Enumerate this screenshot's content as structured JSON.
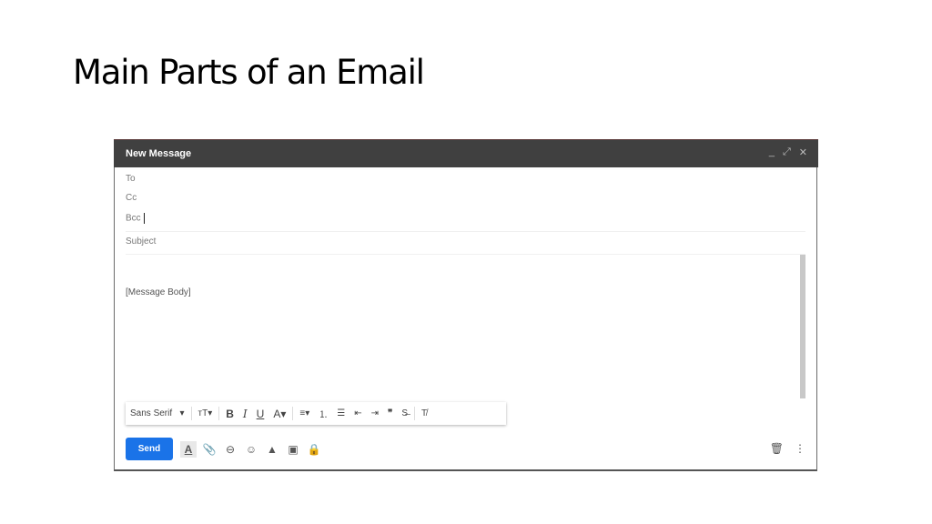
{
  "slide": {
    "title": "Main Parts of an Email"
  },
  "compose": {
    "header_title": "New Message",
    "window_controls": [
      {
        "name": "minimize-icon",
        "glyph": "_"
      },
      {
        "name": "expand-icon",
        "glyph": "⤢"
      },
      {
        "name": "close-icon",
        "glyph": "✕"
      }
    ],
    "fields": {
      "to": "To",
      "cc": "Cc",
      "bcc": "Bcc",
      "subject": "Subject"
    },
    "body": "[Message Body]",
    "format_toolbar": {
      "font": "Sans Serif",
      "font_arrow": "▾",
      "size_icon": "ᴛT▾",
      "bold": "B",
      "italic": "I",
      "underline": "U",
      "text_color": "A▾",
      "align": "≡▾",
      "numbered_list": "⒈",
      "bulleted_list": "☰",
      "indent_less": "⇤",
      "indent_more": "⇥",
      "quote": "❞",
      "strikethrough": "S̶",
      "remove_format": "T̸"
    },
    "actions": {
      "send": "Send",
      "formatting": "A",
      "attach": "📎",
      "link": "⊖",
      "emoji": "☺",
      "drive": "▲",
      "photo": "▣",
      "confidential": "🔒",
      "trash": "🗑",
      "more": "⋮"
    },
    "colors": {
      "header_bg": "#404040",
      "send_bg": "#1a73e8"
    }
  }
}
